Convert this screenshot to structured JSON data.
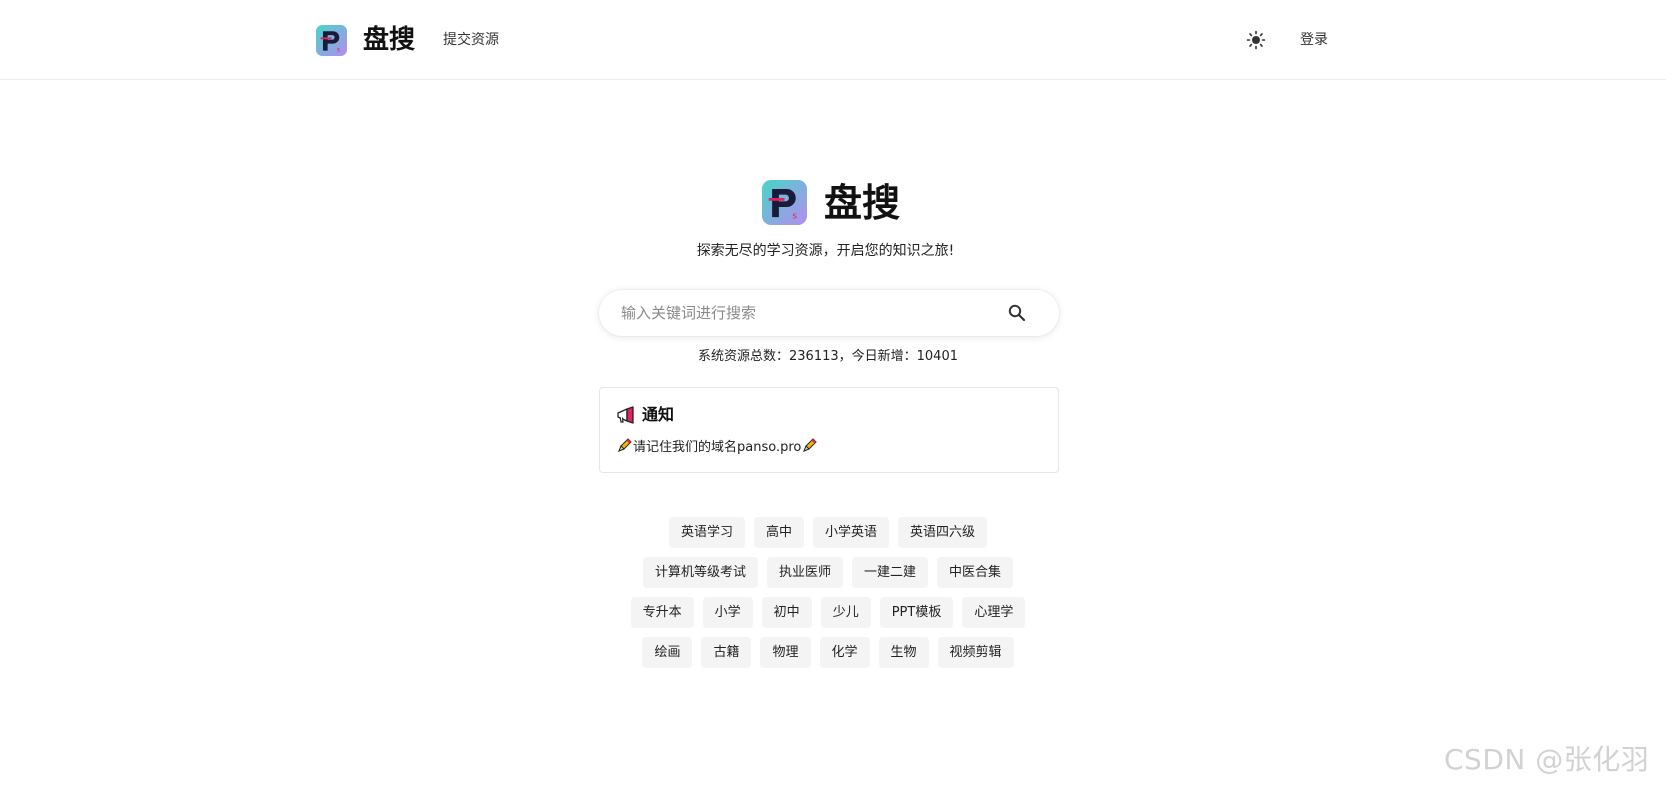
{
  "header": {
    "brand": "盘搜",
    "submit_link": "提交资源",
    "login_link": "登录"
  },
  "hero": {
    "title": "盘搜",
    "tagline": "探索无尽的学习资源，开启您的知识之旅!"
  },
  "search": {
    "placeholder": "输入关键词进行搜索",
    "value": ""
  },
  "stats": {
    "text": "系统资源总数：236113，今日新增：10401"
  },
  "notice": {
    "title": "通知",
    "message": "请记住我们的域名panso.pro"
  },
  "tags": [
    [
      "英语学习",
      "高中",
      "小学英语",
      "英语四六级"
    ],
    [
      "计算机等级考试",
      "执业医师",
      "一建二建",
      "中医合集"
    ],
    [
      "专升本",
      "小学",
      "初中",
      "少儿",
      "PPT模板",
      "心理学"
    ],
    [
      "绘画",
      "古籍",
      "物理",
      "化学",
      "生物",
      "视频剪辑"
    ]
  ],
  "watermark": "CSDN @张化羽",
  "colors": {
    "logo_gradient_start": "#46d6c8",
    "logo_gradient_end": "#b48cf0",
    "logo_letter": "#1a1a3a",
    "logo_accent": "#e0245e",
    "tag_background": "#f4f4f5",
    "border": "#e6e6e6"
  },
  "icons": {
    "logo": "ps-logo-icon",
    "theme": "sun-icon",
    "search": "search-icon",
    "notice": "megaphone-icon",
    "pencil": "pencil-icon"
  }
}
